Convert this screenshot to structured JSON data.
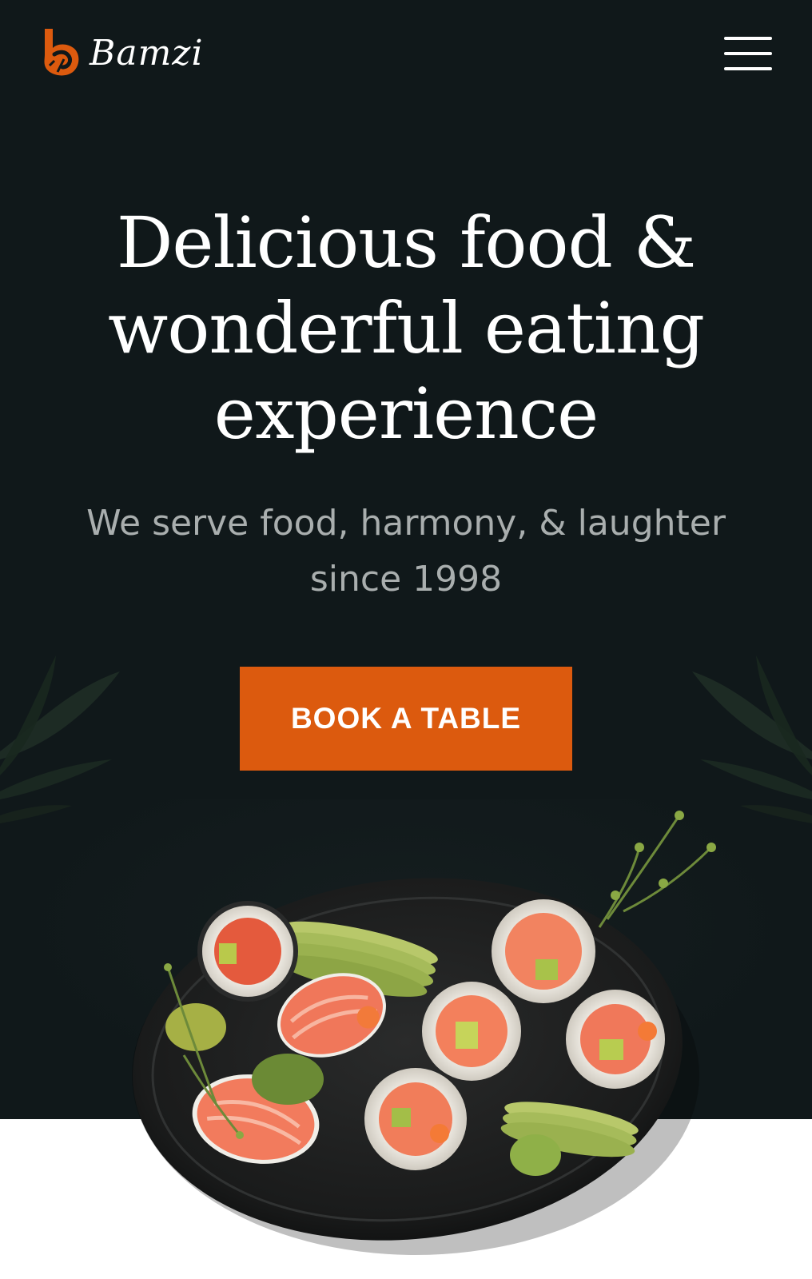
{
  "header": {
    "logo_text": "Bamzi",
    "menu_icon": "hamburger-menu-icon"
  },
  "hero": {
    "headline_line1": "Delicious food &",
    "headline_line2": "wonderful eating",
    "headline_line3": "experience",
    "subline_line1": "We serve food, harmony, & laughter",
    "subline_line2": "since 1998",
    "cta_label": "BOOK A TABLE"
  },
  "colors": {
    "background": "#10181a",
    "accent": "#dc5a0e",
    "text_primary": "#ffffff",
    "text_muted": "#a9aeae"
  },
  "images": {
    "hero_image": "sushi-platter-image"
  }
}
